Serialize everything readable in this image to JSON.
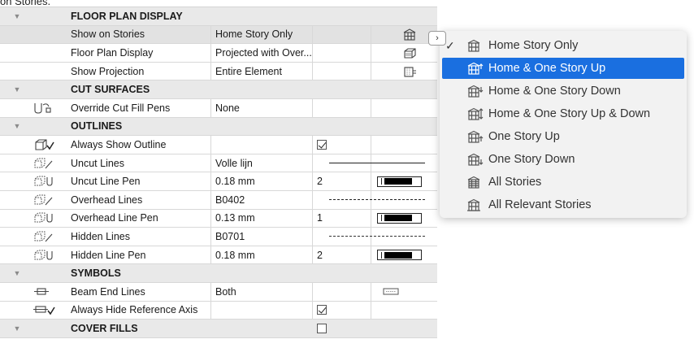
{
  "top_text": "on Stories.",
  "rows": [
    {
      "type": "header",
      "label": "FLOOR PLAN DISPLAY"
    },
    {
      "type": "row",
      "label": "Show on Stories",
      "value": "Home Story Only",
      "right_icon": "stories-icon",
      "selected": true
    },
    {
      "type": "row",
      "label": "Floor Plan Display",
      "value": "Projected with Over...",
      "right_icon": "display-mode-icon"
    },
    {
      "type": "row",
      "label": "Show Projection",
      "value": "Entire Element",
      "right_icon": "projection-icon"
    },
    {
      "type": "header",
      "label": "CUT SURFACES"
    },
    {
      "type": "row",
      "label": "Override Cut Fill Pens",
      "value": "None",
      "left_icon": "override-pen-icon"
    },
    {
      "type": "header",
      "label": "OUTLINES"
    },
    {
      "type": "row",
      "label": "Always Show Outline",
      "value": "",
      "left_icon": "outline-icon",
      "checkbox": true
    },
    {
      "type": "row",
      "label": "Uncut Lines",
      "value": "Volle lijn",
      "left_icon": "uncut-lines-icon",
      "line": "solid"
    },
    {
      "type": "row",
      "label": "Uncut Line Pen",
      "value": "0.18 mm",
      "pen_num": "2",
      "left_icon": "uncut-pen-icon",
      "pen": true
    },
    {
      "type": "row",
      "label": "Overhead Lines",
      "value": "B0402",
      "left_icon": "overhead-lines-icon",
      "line": "dashed"
    },
    {
      "type": "row",
      "label": "Overhead Line Pen",
      "value": "0.13 mm",
      "pen_num": "1",
      "left_icon": "overhead-pen-icon",
      "pen": true
    },
    {
      "type": "row",
      "label": "Hidden Lines",
      "value": "B0701",
      "left_icon": "hidden-lines-icon",
      "line": "dotted"
    },
    {
      "type": "row",
      "label": "Hidden Line Pen",
      "value": "0.18 mm",
      "pen_num": "2",
      "left_icon": "hidden-pen-icon",
      "pen": true
    },
    {
      "type": "header",
      "label": "SYMBOLS"
    },
    {
      "type": "row",
      "label": "Beam End Lines",
      "value": "Both",
      "left_icon": "beam-end-icon",
      "right_icon": "beam-symbol-icon"
    },
    {
      "type": "row",
      "label": "Always Hide Reference Axis",
      "value": "",
      "left_icon": "hide-axis-icon",
      "checkbox": true
    },
    {
      "type": "header",
      "label": "COVER FILLS",
      "checkbox": false
    }
  ],
  "menu": {
    "items": [
      {
        "label": "Home Story Only",
        "checked": true,
        "icon": "home-story-icon"
      },
      {
        "label": "Home & One Story Up",
        "highlighted": true,
        "icon": "story-up-icon"
      },
      {
        "label": "Home & One Story Down",
        "icon": "story-down-icon"
      },
      {
        "label": "Home & One Story Up & Down",
        "icon": "story-updown-icon"
      },
      {
        "label": "One Story Up",
        "icon": "one-up-icon"
      },
      {
        "label": "One Story Down",
        "icon": "one-down-icon"
      },
      {
        "label": "All Stories",
        "icon": "all-stories-icon"
      },
      {
        "label": "All Relevant Stories",
        "icon": "relevant-stories-icon"
      }
    ],
    "check_glyph": "✓"
  },
  "colors": {
    "highlight": "#1a6fe0",
    "header_bg": "#e9e9e9"
  }
}
